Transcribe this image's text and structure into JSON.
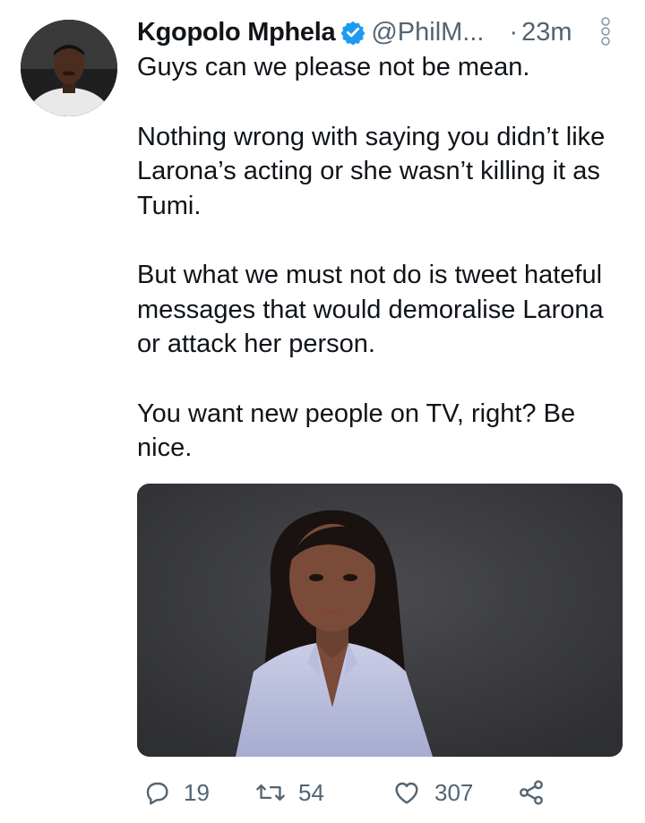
{
  "tweet": {
    "author_name": "Kgopolo Mphela",
    "handle": "@PhilM...",
    "separator": "·",
    "time": "23m",
    "paragraphs": [
      "Guys can we please not be mean.",
      "Nothing wrong with saying you didn’t like Larona’s acting or she wasn’t killing it as Tumi.",
      "But what we must not do is tweet hateful messages that would demoralise Larona or attack her person.",
      "You want new people on TV, right? Be nice."
    ]
  },
  "actions": {
    "reply_count": "19",
    "retweet_count": "54",
    "like_count": "307"
  },
  "icons": {
    "verified": "verified-badge-icon",
    "more": "more-options-icon",
    "reply": "reply-icon",
    "retweet": "retweet-icon",
    "like": "heart-icon",
    "share": "share-icon"
  },
  "colors": {
    "text": "#0f1419",
    "secondary": "#536471",
    "verified": "#1d9bf0",
    "media_background": "#3a3b3e"
  }
}
